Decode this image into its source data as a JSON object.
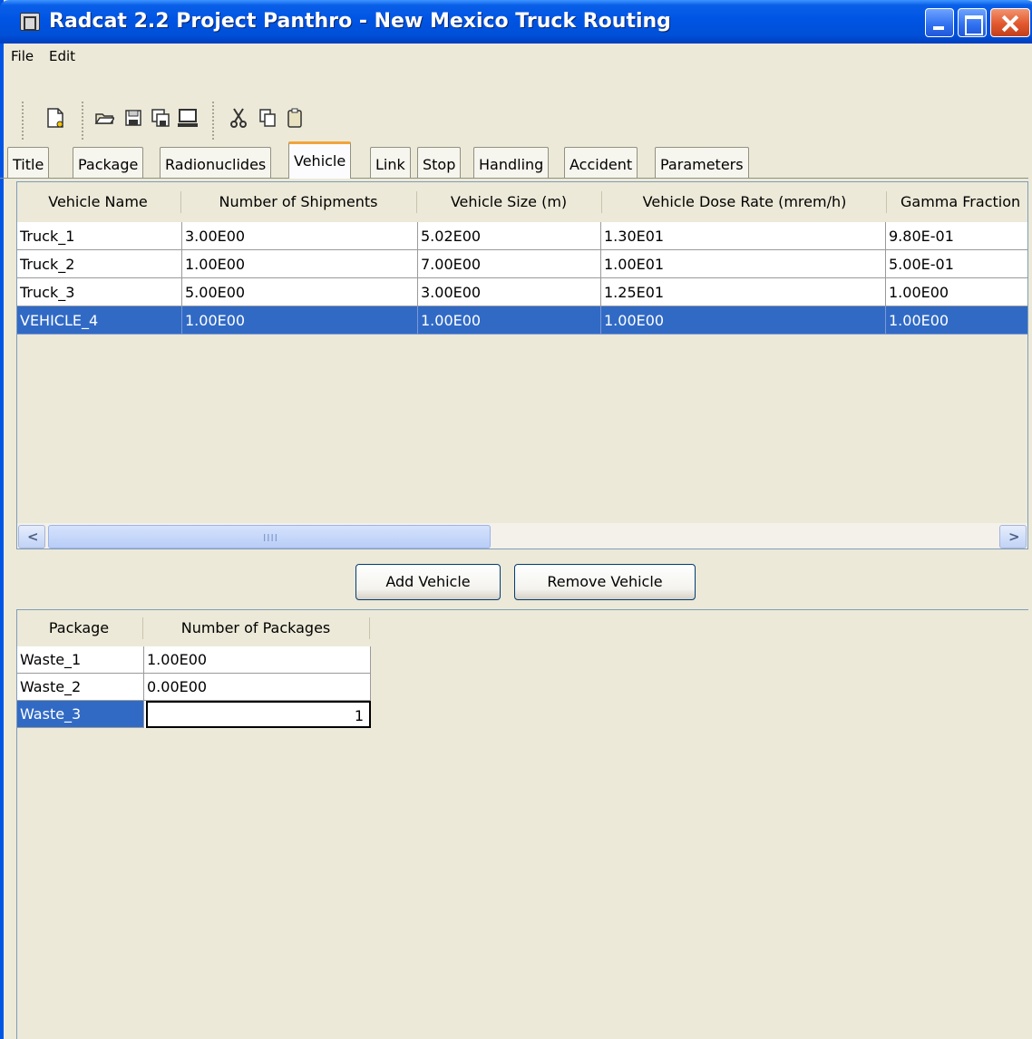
{
  "window": {
    "title": "Radcat 2.2 Project Panthro - New Mexico Truck Routing"
  },
  "menu": {
    "file": "File",
    "edit": "Edit"
  },
  "tabs": [
    "Title",
    "Package",
    "Radionuclides",
    "Vehicle",
    "Link",
    "Stop",
    "Handling",
    "Accident",
    "Parameters"
  ],
  "active_tab": "Vehicle",
  "vehicle_table": {
    "columns": [
      "Vehicle Name",
      "Number of Shipments",
      "Vehicle Size (m)",
      "Vehicle Dose Rate (mrem/h)",
      "Gamma Fraction"
    ],
    "rows": [
      [
        "Truck_1",
        "3.00E00",
        "5.02E00",
        "1.30E01",
        "9.80E-01"
      ],
      [
        "Truck_2",
        "1.00E00",
        "7.00E00",
        "1.00E01",
        "5.00E-01"
      ],
      [
        "Truck_3",
        "5.00E00",
        "3.00E00",
        "1.25E01",
        "1.00E00"
      ],
      [
        "VEHICLE_4",
        "1.00E00",
        "1.00E00",
        "1.00E00",
        "1.00E00"
      ]
    ],
    "selected_row": 3
  },
  "buttons": {
    "add": "Add Vehicle",
    "remove": "Remove Vehicle"
  },
  "package_table": {
    "columns": [
      "Package",
      "Number of Packages"
    ],
    "rows": [
      [
        "Waste_1",
        "1.00E00"
      ],
      [
        "Waste_2",
        "0.00E00"
      ],
      [
        "Waste_3",
        "1"
      ]
    ],
    "editing_row": 2
  },
  "colors": {
    "selection": "#316ac5",
    "titlebar": "#0054e3",
    "tab_highlight": "#f2a43c"
  }
}
